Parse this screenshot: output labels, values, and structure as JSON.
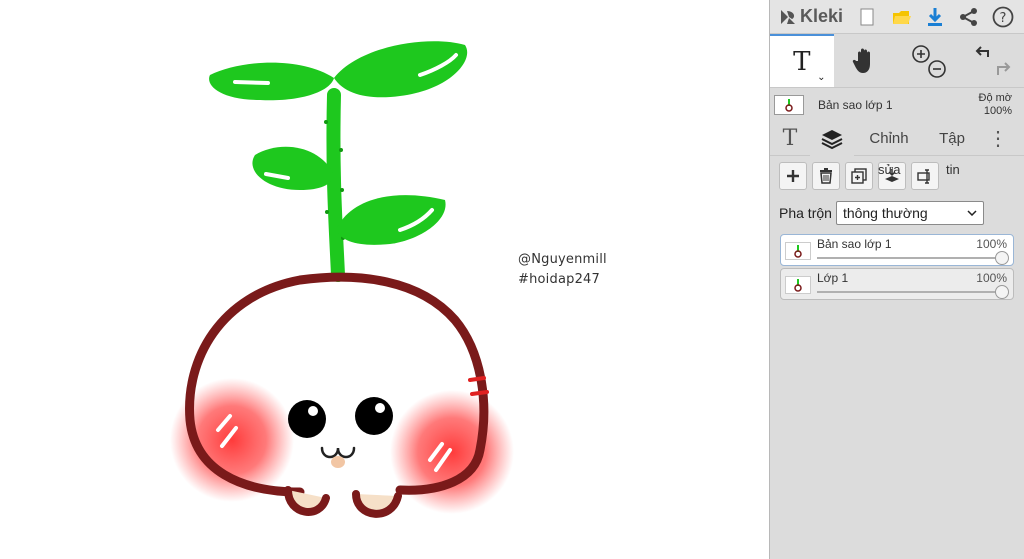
{
  "app": {
    "name": "Kleki"
  },
  "canvas": {
    "watermark_line1": "@Nguyenmill",
    "watermark_line2": "#hoidap247"
  },
  "topbar": {
    "icons": [
      "new-image-icon",
      "open-folder-icon",
      "download-icon",
      "share-icon",
      "help-icon"
    ],
    "help_glyph": "?"
  },
  "tools": {
    "text_tool": "T",
    "caret": "⌄"
  },
  "current_layer": {
    "name": "Bản sao lớp 1",
    "opacity_label": "Độ mờ",
    "opacity_value": "100%"
  },
  "tabs": {
    "text": "T",
    "edit": "Chỉnh",
    "file": "Tập",
    "more": "⋮"
  },
  "layer_actions": {
    "edit_label": "sửa",
    "info_label": "tin"
  },
  "blend": {
    "label": "Pha trộn",
    "value": "thông thường"
  },
  "layers": [
    {
      "name": "Bản sao lớp 1",
      "opacity": "100%",
      "selected": true
    },
    {
      "name": "Lớp 1",
      "opacity": "100%",
      "selected": false
    }
  ],
  "colors": {
    "accent": "#1a7fd4",
    "folder": "#f5c400",
    "leaf": "#1ec81e",
    "outline": "#7a1a1a",
    "blush": "#ff4040"
  }
}
